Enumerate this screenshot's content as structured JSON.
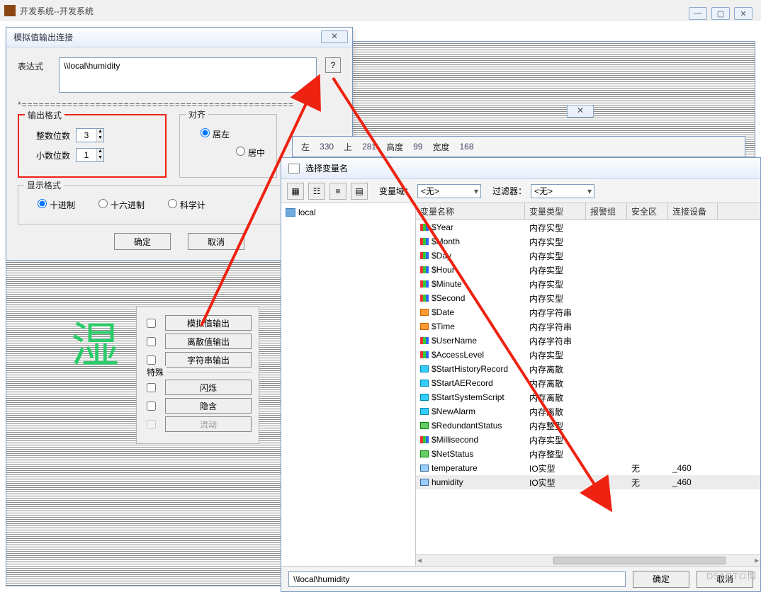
{
  "app": {
    "title": "开发系统--开发系统"
  },
  "win_buttons": {
    "min": "—",
    "max": "▢",
    "close": "✕"
  },
  "bg_text": "湿",
  "dlg1": {
    "title": "模拟值输出连接",
    "expr_label": "表达式",
    "expr_value": "\\\\local\\humidity",
    "expr_btn": "?",
    "divider": "*================================================",
    "output_fmt": {
      "title": "输出格式",
      "int_label": "整数位数",
      "int_value": "3",
      "dec_label": "小数位数",
      "dec_value": "1"
    },
    "align": {
      "title": "对齐",
      "left": "居左",
      "center": "居中"
    },
    "display": {
      "title": "显示格式",
      "dec": "十进制",
      "hex": "十六进制",
      "sci": "科学计"
    },
    "ok": "确定",
    "cancel": "取消"
  },
  "dlg2": {
    "analog": "模拟值输出",
    "discrete": "离散值输出",
    "string": "字符串输出",
    "special": "特殊",
    "blink": "闪烁",
    "hide": "隐含",
    "flow": "流动"
  },
  "posbar": {
    "l_lbl": "左",
    "l": "330",
    "t_lbl": "上",
    "t": "281",
    "h_lbl": "高度",
    "h": "99",
    "w_lbl": "宽度",
    "w": "168"
  },
  "picker": {
    "title": "选择变量名",
    "scope_lbl": "变量域：",
    "scope_val": "<无>",
    "filter_lbl": "过滤器：",
    "filter_val": "<无>",
    "tree_root": "local",
    "cols": {
      "name": "变量名称",
      "type": "变量类型",
      "alarm": "报警组",
      "safe": "安全区",
      "dev": "连接设备"
    },
    "rows": [
      {
        "name": "$Year",
        "type": "内存实型",
        "icon": "vi-grid"
      },
      {
        "name": "$Month",
        "type": "内存实型",
        "icon": "vi-grid"
      },
      {
        "name": "$Day",
        "type": "内存实型",
        "icon": "vi-grid"
      },
      {
        "name": "$Hour",
        "type": "内存实型",
        "icon": "vi-grid"
      },
      {
        "name": "$Minute",
        "type": "内存实型",
        "icon": "vi-grid"
      },
      {
        "name": "$Second",
        "type": "内存实型",
        "icon": "vi-grid"
      },
      {
        "name": "$Date",
        "type": "内存字符串",
        "icon": "vi-str"
      },
      {
        "name": "$Time",
        "type": "内存字符串",
        "icon": "vi-str"
      },
      {
        "name": "$UserName",
        "type": "内存字符串",
        "icon": "vi-grid"
      },
      {
        "name": "$AccessLevel",
        "type": "内存实型",
        "icon": "vi-grid"
      },
      {
        "name": "$StartHistoryRecord",
        "type": "内存离散",
        "icon": "vi-io"
      },
      {
        "name": "$StartAERecord",
        "type": "内存离散",
        "icon": "vi-io"
      },
      {
        "name": "$StartSystemScript",
        "type": "内存离散",
        "icon": "vi-io"
      },
      {
        "name": "$NewAlarm",
        "type": "内存离散",
        "icon": "vi-io"
      },
      {
        "name": "$RedundantStatus",
        "type": "内存整型",
        "icon": "vi-int"
      },
      {
        "name": "$Millisecond",
        "type": "内存实型",
        "icon": "vi-grid"
      },
      {
        "name": "$NetStatus",
        "type": "内存整型",
        "icon": "vi-int"
      },
      {
        "name": "temperature",
        "type": "IO实型",
        "safe": "无",
        "dev": "_460",
        "icon": "vi-tag"
      },
      {
        "name": "humidity",
        "type": "IO实型",
        "safe": "无",
        "dev": "_460",
        "icon": "vi-tag",
        "selected": true
      }
    ],
    "path": "\\\\local\\humidity",
    "ok": "确定",
    "cancel": "取消"
  },
  "mini_close": "✕",
  "watermark": "D51CTO博"
}
